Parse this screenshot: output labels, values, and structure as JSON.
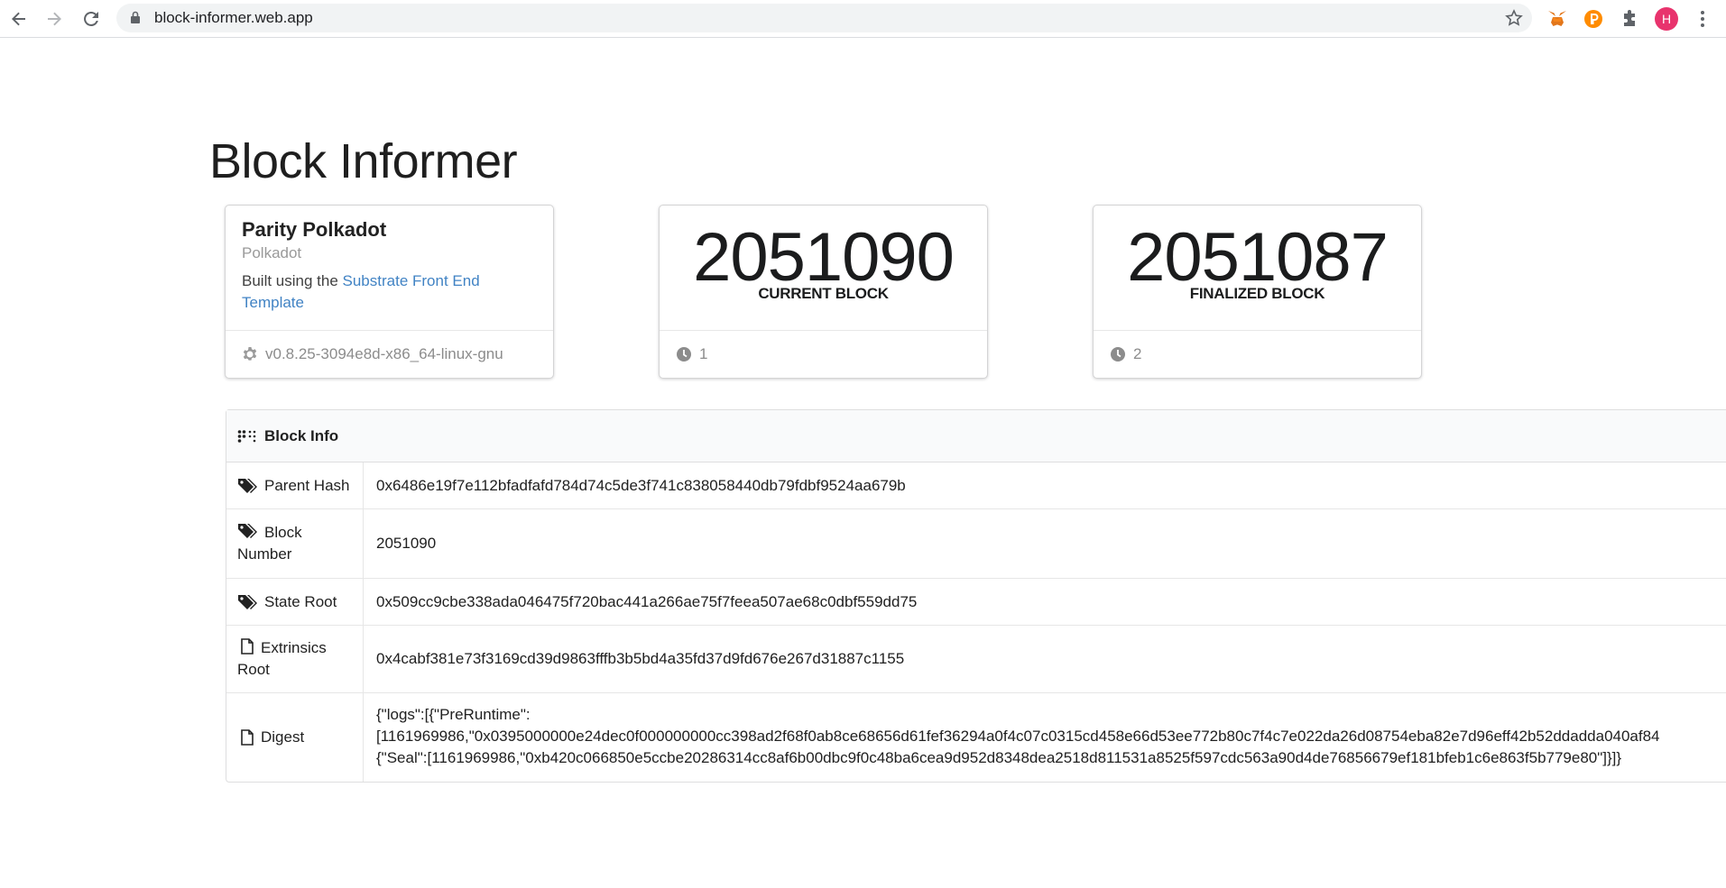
{
  "browser": {
    "url": "block-informer.web.app",
    "avatar_letter": "H",
    "icons": [
      "back-icon",
      "forward-icon",
      "reload-icon",
      "lock-icon",
      "star-icon",
      "metamask-icon",
      "polkadot-js-icon",
      "extensions-icon",
      "avatar",
      "menu-icon"
    ]
  },
  "page": {
    "title": "Block Informer"
  },
  "node_card": {
    "name": "Parity Polkadot",
    "chain": "Polkadot",
    "built_prefix": "Built using the ",
    "link_text": "Substrate Front End Template",
    "version": "v0.8.25-3094e8d-x86_64-linux-gnu"
  },
  "current_block_card": {
    "value": "2051090",
    "label": "CURRENT BLOCK",
    "timer": "1"
  },
  "finalized_block_card": {
    "value": "2051087",
    "label": "FINALIZED BLOCK",
    "timer": "2"
  },
  "block_info": {
    "header": "Block Info",
    "rows": [
      {
        "icon": "tags-icon",
        "label": "Parent Hash",
        "value": "0x6486e19f7e112bfadfafd784d74c5de3f741c838058440db79fdbf9524aa679b"
      },
      {
        "icon": "tags-icon",
        "label": "Block Number",
        "value": "2051090"
      },
      {
        "icon": "tags-icon",
        "label": "State Root",
        "value": "0x509cc9cbe338ada046475f720bac441a266ae75f7feea507ae68c0dbf559dd75"
      },
      {
        "icon": "file-icon",
        "label": "Extrinsics Root",
        "value": "0x4cabf381e73f3169cd39d9863fffb3b5bd4a35fd37d9fd676e267d31887c1155"
      },
      {
        "icon": "file-icon",
        "label": "Digest",
        "value_lines": [
          "{\"logs\":[{\"PreRuntime\":",
          "[1161969986,\"0x0395000000e24dec0f000000000cc398ad2f68f0ab8ce68656d61fef36294a0f4c07c0315cd458e66d53ee772b80c7f4c7e022da26d08754eba82e7d96eff42b52ddadda040af84",
          "{\"Seal\":[1161969986,\"0xb420c066850e5ccbe20286314cc8af6b00dbc9f0c48ba6cea9d952d8348dea2518d811531a8525f597cdc563a90d4de76856679ef181bfeb1c6e863f5b779e80\"]}]}"
        ]
      }
    ]
  },
  "colors": {
    "link": "#4183c4",
    "avatar": "#e8336d",
    "border": "#d4d4d5"
  }
}
